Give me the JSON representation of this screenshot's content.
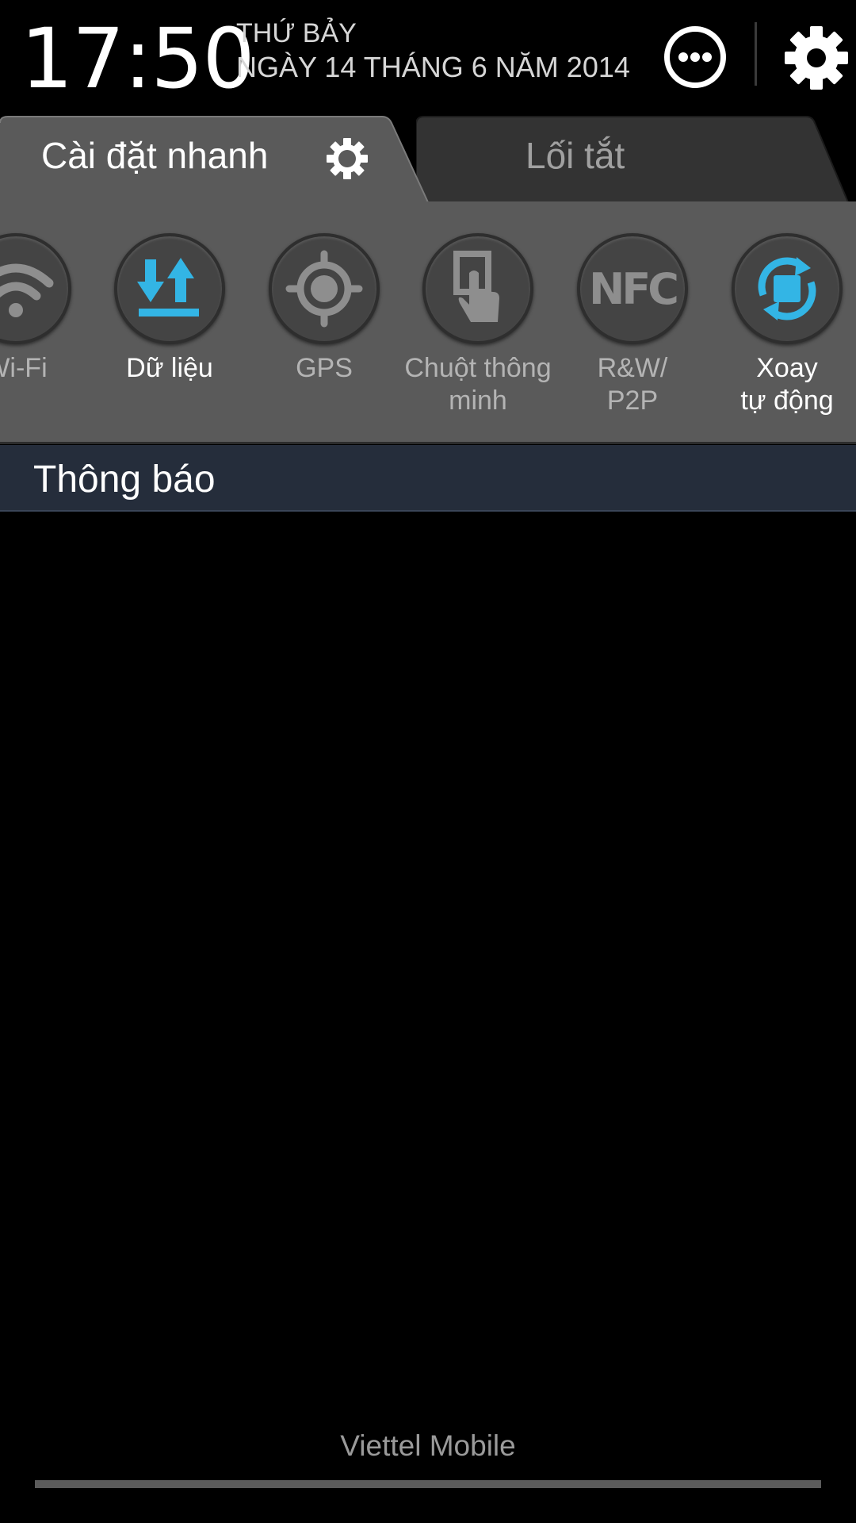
{
  "status": {
    "time": "17:50",
    "day": "THỨ BẢY",
    "date": "NGÀY 14 THÁNG 6 NĂM 2014",
    "more_icon": "more-dots-icon",
    "settings_icon": "gear-icon"
  },
  "tabs": [
    {
      "label": "Cài  đặt nhanh",
      "active": true,
      "icon": "gear-icon"
    },
    {
      "label": "Lối tắt",
      "active": false
    }
  ],
  "toggles": [
    {
      "label": "Wi-Fi",
      "icon": "wifi-icon",
      "on": false
    },
    {
      "label": "Dữ liệu",
      "icon": "data-transfer-icon",
      "on": true
    },
    {
      "label": "GPS",
      "icon": "gps-icon",
      "on": false
    },
    {
      "label": "Chuột thông minh",
      "label_line1": "Chuột thông",
      "label_line2": "minh",
      "icon": "smart-mouse-icon",
      "on": false
    },
    {
      "label": "R&W/ P2P",
      "label_line1": "R&W/",
      "label_line2": "P2P",
      "icon": "nfc-icon",
      "icon_text": "NFC",
      "on": false
    },
    {
      "label": "Xoay tự  động",
      "label_line1": "Xoay",
      "label_line2": "tự  động",
      "icon": "auto-rotate-icon",
      "on": true
    }
  ],
  "notifications": {
    "title": "Thông báo"
  },
  "carrier": "Viettel Mobile",
  "colors": {
    "accent": "#33b5e5",
    "panel": "#5a5a5a",
    "tab_active": "#5a5a5a",
    "tab_inactive": "#333333",
    "notif_header": "#252d3b"
  }
}
